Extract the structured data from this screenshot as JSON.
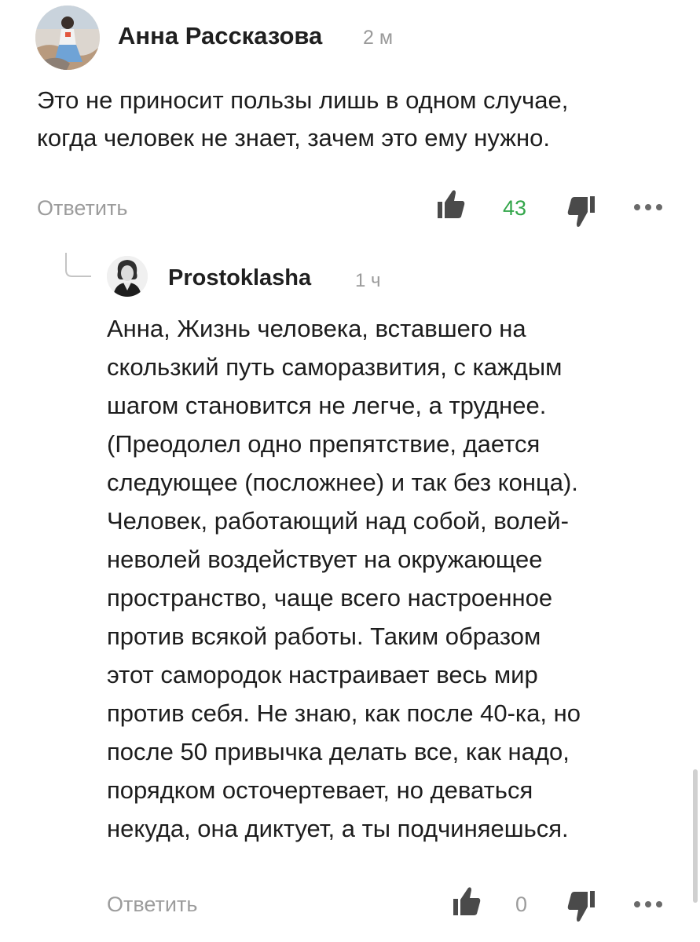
{
  "comments": [
    {
      "author": "Анна Рассказова",
      "time": "2 м",
      "text": "Это не приносит пользы лишь в одном случае,\nкогда человек не знает, зачем это ему нужно.",
      "reply_label": "Ответить",
      "likes": "43",
      "avatar_icon": "user-photo-avatar",
      "like_icon": "thumbs-up-icon",
      "dislike_icon": "thumbs-down-icon",
      "more_icon": "more-dots-icon"
    },
    {
      "author": "Prostoklasha",
      "time": "1 ч",
      "text": "Анна, Жизнь человека, вставшего на\nскользкий путь саморазвития, с каждым\nшагом становится не легче, а труднее.\n(Преодолел одно препятствие, дается\nследующее (посложнее) и так без конца).\nЧеловек, работающий над собой, волей-\nневолей воздействует на окружающее\nпространство, чаще всего настроенное\nпротив всякой работы. Таким образом\nэтот самородок настраивает весь мир\nпротив себя. Не знаю, как после 40-ка, но\nпосле 50 привычка делать все, как надо,\nпорядком осточертевает, но деваться\nнекуда, она диктует, а ты подчиняешься.",
      "reply_label": "Ответить",
      "likes": "0",
      "avatar_icon": "user-photo-avatar",
      "like_icon": "thumbs-up-icon",
      "dislike_icon": "thumbs-down-icon",
      "more_icon": "more-dots-icon"
    }
  ],
  "colors": {
    "positive_count": "#33a64a",
    "muted": "#9c9c9c",
    "icon": "#4a4a4a",
    "text": "#1d1d1d"
  }
}
